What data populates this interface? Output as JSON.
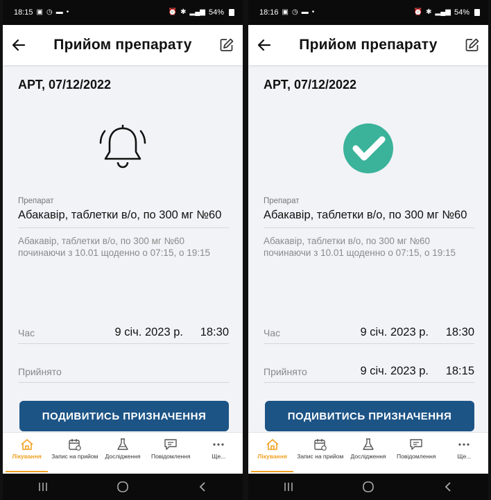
{
  "screens": [
    {
      "status_time": "18:15",
      "battery": "54%",
      "title": "Прийом препарату",
      "date_title": "АРТ, 07/12/2022",
      "state_icon": "bell-icon",
      "drug_label": "Препарат",
      "drug_name": "Абакавір, таблетки в/о, по 300 мг №60",
      "drug_desc": "Абакавір, таблетки в/о, по 300 мг №60 починаючи з 10.01 щоденно о 07:15, о 19:15",
      "time_label": "Час",
      "time_date": "9 січ. 2023 р.",
      "time_value": "18:30",
      "taken_label": "Прийнято",
      "taken_date": "",
      "taken_time": "",
      "button_label": "ПОДИВИТИСЬ ПРИЗНАЧЕННЯ"
    },
    {
      "status_time": "18:16",
      "battery": "54%",
      "title": "Прийом препарату",
      "date_title": "АРТ, 07/12/2022",
      "state_icon": "check-circle-icon",
      "drug_label": "Препарат",
      "drug_name": "Абакавір, таблетки в/о, по 300 мг №60",
      "drug_desc": "Абакавір, таблетки в/о, по 300 мг №60 починаючи з 10.01 щоденно о 07:15, о 19:15",
      "time_label": "Час",
      "time_date": "9 січ. 2023 р.",
      "time_value": "18:30",
      "taken_label": "Прийнято",
      "taken_date": "9 січ. 2023 р.",
      "taken_time": "18:15",
      "button_label": "ПОДИВИТИСЬ ПРИЗНАЧЕННЯ"
    }
  ],
  "nav": [
    {
      "label": "Лікування",
      "icon": "home-icon",
      "active": true
    },
    {
      "label": "Запис на прийом",
      "icon": "calendar-icon",
      "active": false
    },
    {
      "label": "Дослідження",
      "icon": "flask-icon",
      "active": false
    },
    {
      "label": "Повідомлення",
      "icon": "message-icon",
      "active": false
    },
    {
      "label": "Ще...",
      "icon": "more-icon",
      "active": false
    }
  ],
  "colors": {
    "primary_button": "#1d5486",
    "accent": "#f0a020",
    "check": "#3bb39a"
  }
}
